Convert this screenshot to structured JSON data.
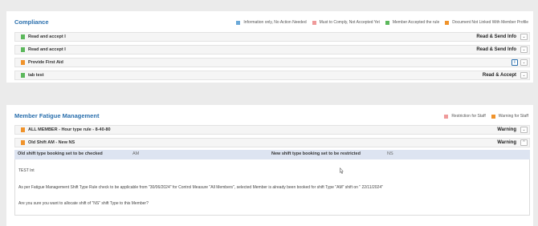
{
  "compliance": {
    "title": "Compliance",
    "legend": [
      {
        "label": "Information only, No Action Needed",
        "color": "#6aa8d8"
      },
      {
        "label": "Must to Comply, Not Accepted Yet",
        "color": "#ef9a9a"
      },
      {
        "label": "Member Accepted the rule",
        "color": "#5cb85c"
      },
      {
        "label": "Document Not Linked With Member Profile",
        "color": "#f0932b"
      }
    ],
    "rows": [
      {
        "label": "Read and accept I",
        "action": "Read & Send Info",
        "color": "#5cb85c"
      },
      {
        "label": "Read and accept I",
        "action": "Read & Send Info",
        "color": "#5cb85c"
      },
      {
        "label": "Provide First Aid",
        "action": "",
        "color": "#f0932b",
        "info_icon": "info-icon"
      },
      {
        "label": "tab test",
        "action": "Read & Accept",
        "color": "#5cb85c"
      }
    ]
  },
  "fatigue": {
    "title": "Member Fatigue Management",
    "legend": [
      {
        "label": "Restriction for Staff",
        "color": "#ef9a9a"
      },
      {
        "label": "Warning for Staff",
        "color": "#f0932b"
      }
    ],
    "rows": [
      {
        "label": "ALL MEMBER - Hour type rule - 8-40-80",
        "action": "Warning",
        "color": "#f0932b",
        "expanded": false
      },
      {
        "label": "Old Shift AM - New NS",
        "action": "Warning",
        "color": "#f0932b",
        "expanded": true
      }
    ],
    "detail": {
      "old_label": "Old shift type booking set to be checked",
      "old_value": "AM",
      "new_label": "New shift type booking set to be restricted",
      "new_value": "NS",
      "lines": [
        "TEST Int",
        "As per Fatigue Management Shift Type Rule check to be applicable from \"30/06/2024\" for Control Measure \"All Members\", selected Member is already been booked for shift Type \"AM\" shift on \" 22/11/2024\"",
        "Are you sure you want to allocate shift of \"NS\" shift Type to this Member?"
      ]
    }
  },
  "icons": {
    "chevron_down": "chevron-down-icon",
    "chevron_up": "chevron-up-icon",
    "cursor": "mouse-cursor-icon"
  }
}
